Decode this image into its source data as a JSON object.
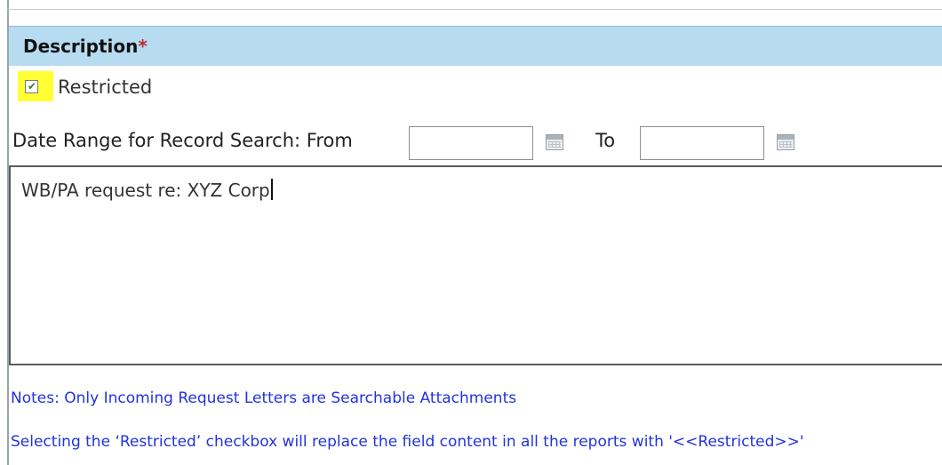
{
  "section": {
    "title": "Description",
    "required_marker": "*"
  },
  "restricted": {
    "label": "Restricted",
    "checked": true
  },
  "date_range": {
    "label": "Date Range for Record Search: From",
    "from_value": "",
    "to_label": "To",
    "to_value": ""
  },
  "description": {
    "value": "WB/PA request re: XYZ Corp"
  },
  "notes": {
    "line1": "Notes: Only Incoming Request Letters are Searchable Attachments",
    "line2": "Selecting the ‘Restricted’ checkbox will replace the field content in all the reports with '<<Restricted>>'"
  },
  "icons": {
    "calendar": "calendar-icon",
    "check": "checkmark-icon"
  },
  "colors": {
    "header_bg": "#b7dcf1",
    "required": "#c0282b",
    "highlight": "#ffff33",
    "note_text": "#2233dd"
  }
}
